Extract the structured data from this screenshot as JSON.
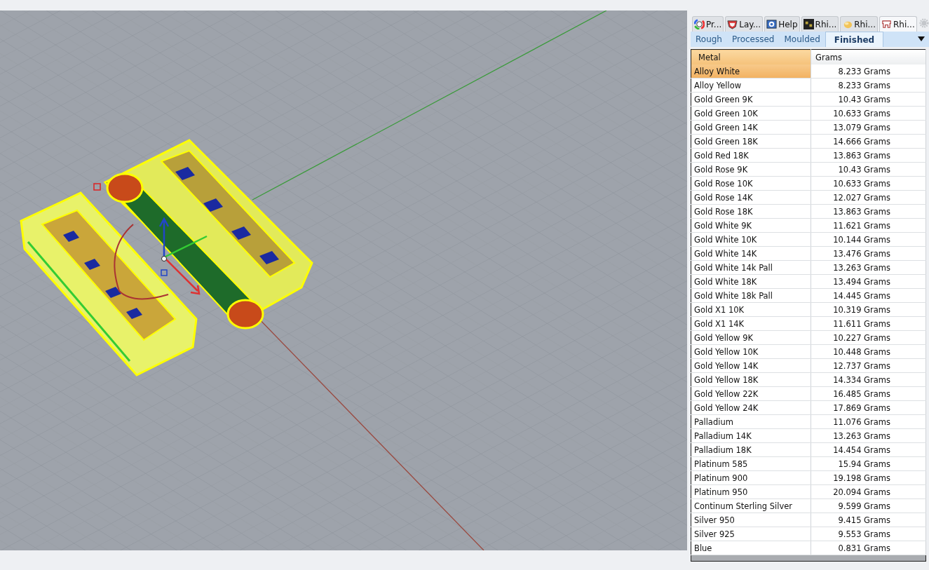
{
  "panel_tabs": [
    {
      "kind": "color-wheel",
      "label": "Pr...",
      "selected": false
    },
    {
      "kind": "layers",
      "label": "Lay...",
      "selected": false
    },
    {
      "kind": "help",
      "label": "Help",
      "selected": false
    },
    {
      "kind": "rg",
      "label": "Rhi...",
      "selected": false
    },
    {
      "kind": "blob",
      "label": "Rhi...",
      "selected": false
    },
    {
      "kind": "tooth",
      "label": "Rhi...",
      "selected": true
    }
  ],
  "stage_tabs": [
    {
      "label": "Rough",
      "selected": false
    },
    {
      "label": "Processed",
      "selected": false
    },
    {
      "label": "Moulded",
      "selected": false
    },
    {
      "label": "Finished",
      "selected": true
    }
  ],
  "table": {
    "columns": [
      "Metal",
      "Grams"
    ],
    "rows": [
      {
        "metal": "Alloy White",
        "grams": "8.233 Grams",
        "selected": true
      },
      {
        "metal": "Alloy Yellow",
        "grams": "8.233 Grams",
        "selected": false
      },
      {
        "metal": "Gold Green 9K",
        "grams": "10.43 Grams",
        "selected": false
      },
      {
        "metal": "Gold Green 10K",
        "grams": "10.633 Grams",
        "selected": false
      },
      {
        "metal": "Gold Green 14K",
        "grams": "13.079 Grams",
        "selected": false
      },
      {
        "metal": "Gold Green 18K",
        "grams": "14.666 Grams",
        "selected": false
      },
      {
        "metal": "Gold Red 18K",
        "grams": "13.863 Grams",
        "selected": false
      },
      {
        "metal": "Gold Rose 9K",
        "grams": "10.43 Grams",
        "selected": false
      },
      {
        "metal": "Gold Rose 10K",
        "grams": "10.633 Grams",
        "selected": false
      },
      {
        "metal": "Gold Rose 14K",
        "grams": "12.027 Grams",
        "selected": false
      },
      {
        "metal": "Gold Rose 18K",
        "grams": "13.863 Grams",
        "selected": false
      },
      {
        "metal": "Gold White 9K",
        "grams": "11.621 Grams",
        "selected": false
      },
      {
        "metal": "Gold White 10K",
        "grams": "10.144 Grams",
        "selected": false
      },
      {
        "metal": "Gold White 14K",
        "grams": "13.476 Grams",
        "selected": false
      },
      {
        "metal": "Gold White 14k Pall",
        "grams": "13.263 Grams",
        "selected": false
      },
      {
        "metal": "Gold White 18K",
        "grams": "13.494 Grams",
        "selected": false
      },
      {
        "metal": "Gold White 18k Pall",
        "grams": "14.445 Grams",
        "selected": false
      },
      {
        "metal": "Gold X1 10K",
        "grams": "10.319 Grams",
        "selected": false
      },
      {
        "metal": "Gold X1 14K",
        "grams": "11.611 Grams",
        "selected": false
      },
      {
        "metal": "Gold Yellow 9K",
        "grams": "10.227 Grams",
        "selected": false
      },
      {
        "metal": "Gold Yellow 10K",
        "grams": "10.448 Grams",
        "selected": false
      },
      {
        "metal": "Gold Yellow 14K",
        "grams": "12.737 Grams",
        "selected": false
      },
      {
        "metal": "Gold Yellow 18K",
        "grams": "14.334 Grams",
        "selected": false
      },
      {
        "metal": "Gold Yellow 22K",
        "grams": "16.485 Grams",
        "selected": false
      },
      {
        "metal": "Gold Yellow 24K",
        "grams": "17.869 Grams",
        "selected": false
      },
      {
        "metal": "Palladium",
        "grams": "11.076 Grams",
        "selected": false
      },
      {
        "metal": "Palladium 14K",
        "grams": "13.263 Grams",
        "selected": false
      },
      {
        "metal": "Palladium 18K",
        "grams": "14.454 Grams",
        "selected": false
      },
      {
        "metal": "Platinum 585",
        "grams": "15.94 Grams",
        "selected": false
      },
      {
        "metal": "Platinum 900",
        "grams": "19.198 Grams",
        "selected": false
      },
      {
        "metal": "Platinum 950",
        "grams": "20.094 Grams",
        "selected": false
      },
      {
        "metal": "Continum Sterling Silver",
        "grams": "9.599 Grams",
        "selected": false
      },
      {
        "metal": "Silver 950",
        "grams": "9.415 Grams",
        "selected": false
      },
      {
        "metal": "Silver 925",
        "grams": "9.553 Grams",
        "selected": false
      },
      {
        "metal": "Blue",
        "grams": "0.831 Grams",
        "selected": false
      }
    ]
  }
}
